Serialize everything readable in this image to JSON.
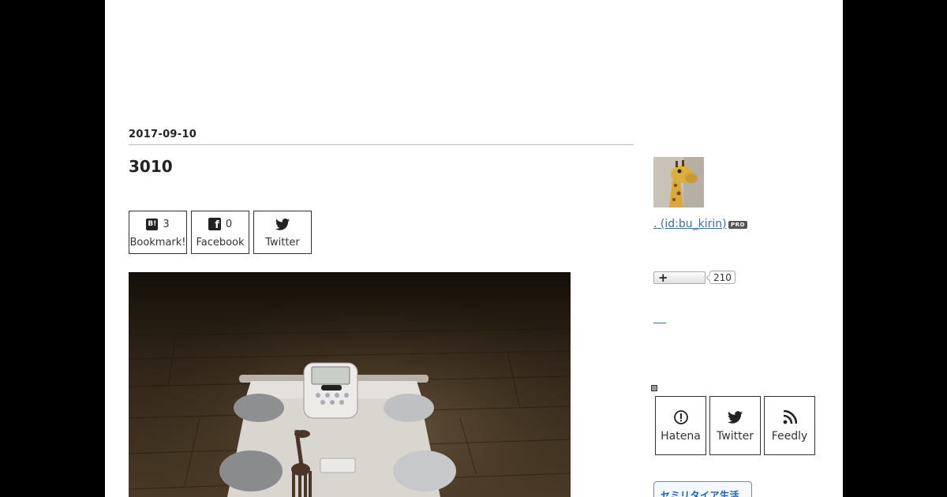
{
  "entry": {
    "date": "2017-09-10",
    "title": "3010"
  },
  "share": {
    "bookmark": {
      "icon": "hatena-bookmark-icon",
      "icon_text": "B!",
      "count": "3",
      "label": "Bookmark!"
    },
    "facebook": {
      "icon": "facebook-icon",
      "icon_text": "f",
      "count": "0",
      "label": "Facebook"
    },
    "twitter": {
      "icon": "twitter-icon",
      "label": "Twitter"
    }
  },
  "sidebar": {
    "user_link": ". (id:bu_kirin)",
    "pro_badge": "PRO",
    "reader_count": "210",
    "subscribe": {
      "hatena": "Hatena",
      "twitter": "Twitter",
      "feedly": "Feedly"
    },
    "banner_text": "セミリタイア生活"
  },
  "colors": {
    "page_background": "#000000",
    "content_background": "#ffffff",
    "link": "#3a6ea5",
    "border": "#333333"
  }
}
